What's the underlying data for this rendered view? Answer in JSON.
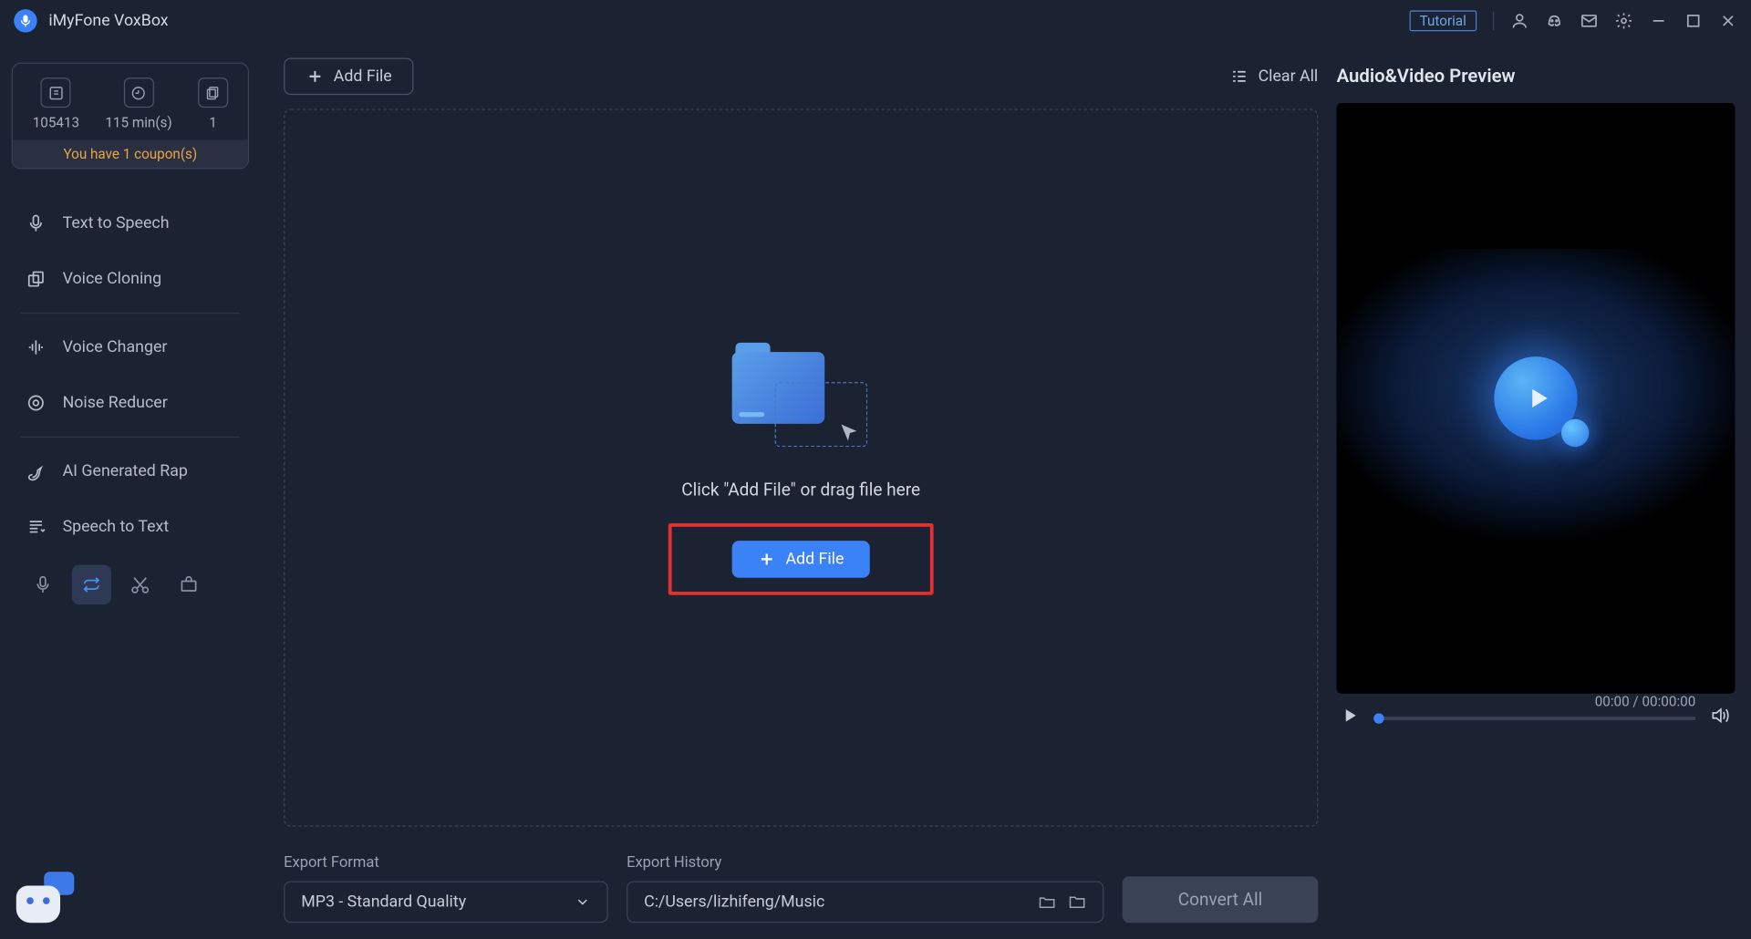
{
  "titlebar": {
    "app_name": "iMyFone VoxBox",
    "tutorial": "Tutorial"
  },
  "stats": {
    "chars": "105413",
    "minutes": "115 min(s)",
    "count": "1",
    "coupon": "You have 1 coupon(s)"
  },
  "nav": {
    "tts": "Text to Speech",
    "voice_cloning": "Voice Cloning",
    "voice_changer": "Voice Changer",
    "noise_reducer": "Noise Reducer",
    "ai_rap": "AI Generated Rap",
    "stt": "Speech to Text"
  },
  "toolbar": {
    "add_file": "Add File",
    "clear_all": "Clear All"
  },
  "dropzone": {
    "hint": "Click \"Add File\" or drag file here",
    "add_file": "Add File"
  },
  "export": {
    "format_label": "Export Format",
    "format_value": "MP3 - Standard Quality",
    "history_label": "Export History",
    "history_value": "C:/Users/lizhifeng/Music",
    "convert": "Convert All"
  },
  "preview": {
    "title": "Audio&Video Preview",
    "time": "00:00 / 00:00:00"
  }
}
